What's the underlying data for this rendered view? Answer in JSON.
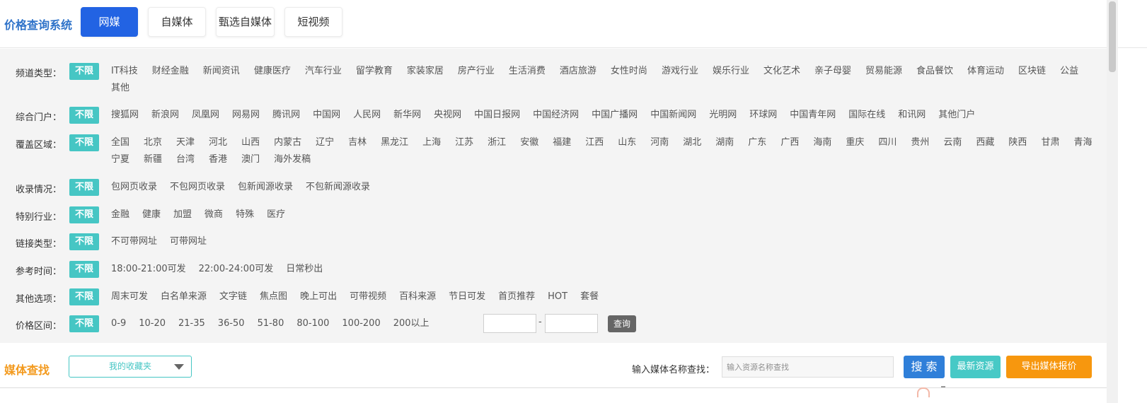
{
  "header": {
    "brand": "价格查询系统",
    "tabs": [
      {
        "label": "网媒",
        "active": true
      },
      {
        "label": "自媒体",
        "active": false
      },
      {
        "label": "甄选自媒体",
        "active": false
      },
      {
        "label": "短视频",
        "active": false
      }
    ]
  },
  "filters": {
    "unlimited_label": "不限",
    "rows": [
      {
        "label": "频道类型：",
        "options": [
          "IT科技",
          "财经金融",
          "新闻资讯",
          "健康医疗",
          "汽车行业",
          "留学教育",
          "家装家居",
          "房产行业",
          "生活消费",
          "酒店旅游",
          "女性时尚",
          "游戏行业",
          "娱乐行业",
          "文化艺术",
          "亲子母婴",
          "贸易能源",
          "食品餐饮",
          "体育运动",
          "区块链",
          "公益",
          "其他"
        ]
      },
      {
        "label": "综合门户：",
        "options": [
          "搜狐网",
          "新浪网",
          "凤凰网",
          "网易网",
          "腾讯网",
          "中国网",
          "人民网",
          "新华网",
          "央视网",
          "中国日报网",
          "中国经济网",
          "中国广播网",
          "中国新闻网",
          "光明网",
          "环球网",
          "中国青年网",
          "国际在线",
          "和讯网",
          "其他门户"
        ]
      },
      {
        "label": "覆盖区域：",
        "options": [
          "全国",
          "北京",
          "天津",
          "河北",
          "山西",
          "内蒙古",
          "辽宁",
          "吉林",
          "黑龙江",
          "上海",
          "江苏",
          "浙江",
          "安徽",
          "福建",
          "江西",
          "山东",
          "河南",
          "湖北",
          "湖南",
          "广东",
          "广西",
          "海南",
          "重庆",
          "四川",
          "贵州",
          "云南",
          "西藏",
          "陕西",
          "甘肃",
          "青海",
          "宁夏",
          "新疆",
          "台湾",
          "香港",
          "澳门",
          "海外发稿"
        ]
      },
      {
        "label": "收录情况：",
        "options": [
          "包网页收录",
          "不包网页收录",
          "包新闻源收录",
          "不包新闻源收录"
        ]
      },
      {
        "label": "特别行业：",
        "options": [
          "金融",
          "健康",
          "加盟",
          "微商",
          "特殊",
          "医疗"
        ]
      },
      {
        "label": "链接类型：",
        "options": [
          "不可带网址",
          "可带网址"
        ]
      },
      {
        "label": "参考时间：",
        "options": [
          "18:00-21:00可发",
          "22:00-24:00可发",
          "日常秒出"
        ]
      },
      {
        "label": "其他选项：",
        "options": [
          "周末可发",
          "白名单来源",
          "文字链",
          "焦点图",
          "晚上可出",
          "可带视频",
          "百科来源",
          "节日可发",
          "首页推荐",
          "HOT",
          "套餐"
        ]
      },
      {
        "label": "价格区间：",
        "options": [
          "0-9",
          "10-20",
          "21-35",
          "36-50",
          "51-80",
          "80-100",
          "100-200",
          "200以上"
        ]
      }
    ],
    "price_range": {
      "min_value": "",
      "max_value": "",
      "separator": "-",
      "query_label": "查询"
    }
  },
  "media_search": {
    "title": "媒体查找",
    "favorites_label": "我的收藏夹",
    "search_label": "输入媒体名称查找：",
    "search_placeholder": "输入资源名称查找",
    "search_button": "搜 索",
    "new_resources_button": "最新资源",
    "export_button": "导出媒体报价"
  },
  "colors": {
    "active_tab": "#2263e3",
    "unlimited_tag": "#46c6c4",
    "brand_title": "#2f73c9",
    "media_title": "#f39a1e",
    "search_button": "#2f7fd9",
    "new_button": "#47c9c6",
    "export_button": "#f7970e"
  }
}
